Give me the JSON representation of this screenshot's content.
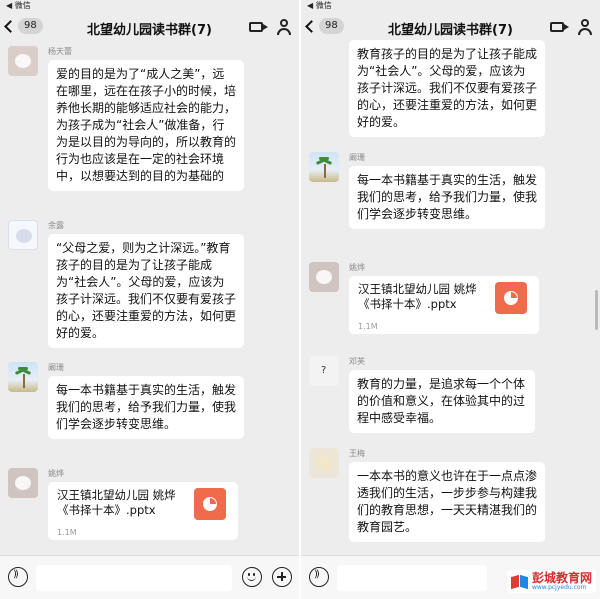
{
  "status_bar": {
    "left": "◀ 微信"
  },
  "header": {
    "badge": "98",
    "title": "北望幼儿园读书群(7)"
  },
  "left_pane": {
    "messages": [
      {
        "sender": "杨天蕾",
        "text": "爱的目的是为了“成人之美”，远在哪里，远在在孩子小的时候，培养他长期的能够适应社会的能力，为孩子成为“社会人”做准备，行为是以目的为导向的，所以教育的行为也应该是在一定的社会环境中，以想要达到的目的为基础的"
      },
      {
        "sender": "余露",
        "text": "“父母之爱，则为之计深远。”教育孩子的目的是为了让孩子能成为“社会人”。父母的爱，应该为孩子计深远。我们不仅要有爱孩子的心，还要注重爱的方法，如何更好的爱。"
      },
      {
        "sender": "阚珊",
        "text": "每一本书籍基于真实的生活，触发我们的思考，给予我们力量，使我们学会逐步转变思维。"
      },
      {
        "sender": "姚烨",
        "file_name": "汉王镇北望幼儿园 姚烨《书择十本》.pptx",
        "file_size": "1.1M"
      }
    ]
  },
  "right_pane": {
    "messages": [
      {
        "sender": "",
        "text": "教育孩子的目的是为了让孩子能成为“社会人”。父母的爱，应该为孩子计深远。我们不仅要有爱孩子的心，还要注重爱的方法，如何更好的爱。"
      },
      {
        "sender": "阚珊",
        "text": "每一本书籍基于真实的生活，触发我们的思考，给予我们力量，使我们学会逐步转变思维。"
      },
      {
        "sender": "姚烨",
        "file_name": "汉王镇北望幼儿园 姚烨《书择十本》.pptx",
        "file_size": "1.1M"
      },
      {
        "sender": "邓芙",
        "text": "教育的力量，是追求每一个个体的价值和意义，在体验其中的过程中感受幸福。"
      },
      {
        "sender": "王梅",
        "text": "一本本书的意义也许在于一点点渗透我们的生活，一步步参与构建我们的教育思想，一天天精湛我们的教育园艺。"
      }
    ]
  },
  "icons": {
    "back": "chevron-left-icon",
    "video": "video-call-icon",
    "members": "person-icon",
    "voice": "voice-icon",
    "emoji": "emoji-icon",
    "more": "plus-icon",
    "file": "pptx-file-icon"
  },
  "watermark": {
    "text": "彭城教育网",
    "sub": "www.pcjyedu.com"
  },
  "colors": {
    "background": "#ededed",
    "bubble": "#ffffff",
    "file_icon": "#ef6b4c"
  }
}
